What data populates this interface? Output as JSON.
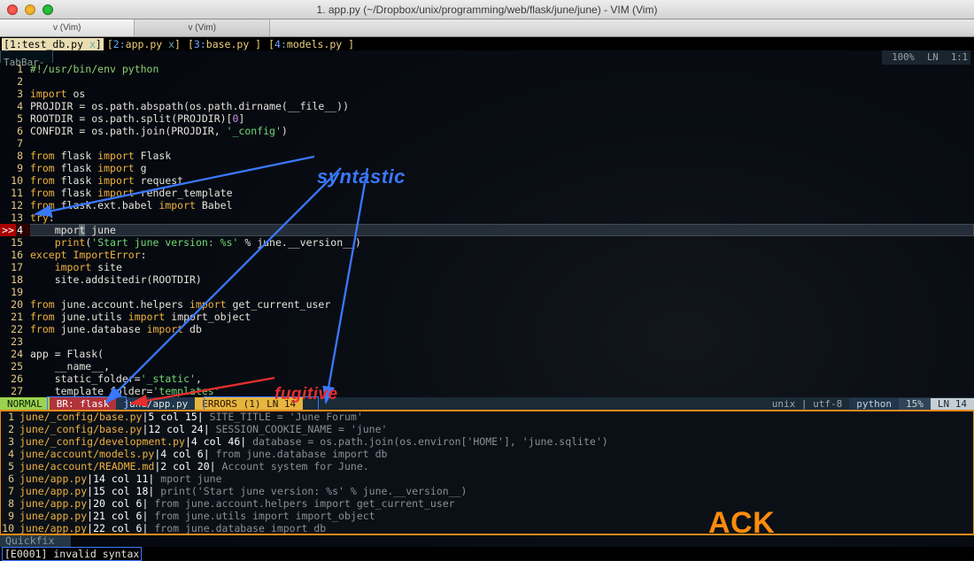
{
  "window": {
    "title": "1. app.py (~/Dropbox/unix/programming/web/flask/june/june) - VIM (Vim)",
    "mactabs": [
      "v (Vim)",
      "v (Vim)"
    ]
  },
  "buffers": [
    {
      "idx": "1",
      "name": "test_db.py",
      "active": true,
      "closable": true
    },
    {
      "idx": "2",
      "name": "app.py",
      "active": false,
      "closable": true
    },
    {
      "idx": "3",
      "name": "base.py",
      "active": false,
      "closable": false
    },
    {
      "idx": "4",
      "name": "models.py",
      "active": false,
      "closable": false
    }
  ],
  "tabbar_label": "-TabBar-",
  "topright": {
    "pct": "100%",
    "ln": "LN",
    "pos": "1:1"
  },
  "code": [
    {
      "n": 1,
      "html": "<span class='c'>#!/usr/bin/env python</span>"
    },
    {
      "n": 2,
      "html": ""
    },
    {
      "n": 3,
      "html": "<span class='imp'>import</span> os"
    },
    {
      "n": 4,
      "html": "PROJDIR = os.path.abspath(os.path.dirname(__file__))"
    },
    {
      "n": 5,
      "html": "ROOTDIR = os.path.split(PROJDIR)[<span class='num'>0</span>]"
    },
    {
      "n": 6,
      "html": "CONFDIR = os.path.join(PROJDIR, <span class='st'>'_config'</span>)"
    },
    {
      "n": 7,
      "html": ""
    },
    {
      "n": 8,
      "html": "<span class='imp'>from</span> flask <span class='imp'>import</span> Flask"
    },
    {
      "n": 9,
      "html": "<span class='imp'>from</span> flask <span class='imp'>import</span> g"
    },
    {
      "n": 10,
      "html": "<span class='imp'>from</span> flask <span class='imp'>import</span> request"
    },
    {
      "n": 11,
      "html": "<span class='imp'>from</span> flask <span class='imp'>import</span> render_template"
    },
    {
      "n": 12,
      "html": "<span class='imp'>from</span> flask.ext.babel <span class='imp'>import</span> Babel"
    },
    {
      "n": 13,
      "html": "<span class='imp'>try</span>:"
    },
    {
      "n": 14,
      "err": true,
      "cursor": true,
      "html": "    mpor<span class='curword'>t</span> june"
    },
    {
      "n": 15,
      "html": "    <span class='kw'>print</span>(<span class='st'>'Start june version: %s'</span> % june.__version__)"
    },
    {
      "n": 16,
      "html": "<span class='imp'>except</span> <span class='kw'>ImportError</span>:"
    },
    {
      "n": 17,
      "html": "    <span class='imp'>import</span> site"
    },
    {
      "n": 18,
      "html": "    site.addsitedir(ROOTDIR)"
    },
    {
      "n": 19,
      "html": ""
    },
    {
      "n": 20,
      "html": "<span class='imp'>from</span> june.account.helpers <span class='imp'>import</span> get_current_user"
    },
    {
      "n": 21,
      "html": "<span class='imp'>from</span> june.utils <span class='imp'>import</span> import_object"
    },
    {
      "n": 22,
      "html": "<span class='imp'>from</span> june.database <span class='imp'>import</span> db"
    },
    {
      "n": 23,
      "html": ""
    },
    {
      "n": 24,
      "html": "app = Flask("
    },
    {
      "n": 25,
      "html": "    __name__,"
    },
    {
      "n": 26,
      "html": "    static_folder=<span class='st'>'_static'</span>,"
    },
    {
      "n": 27,
      "html": "    template_folder=<span class='st'>'templates'</span>"
    }
  ],
  "status": {
    "mode": "NORMAL",
    "branch": "BR: flask",
    "file": "june/app.py",
    "errors": "ERRORS (1) LN 14",
    "enc": "unix | utf-8",
    "ft": "python",
    "pct": "15%",
    "ln": "LN  14"
  },
  "quickfix": [
    {
      "n": 1,
      "path": "june/_config/base.py",
      "pos": "5 col 15",
      "txt": " SITE_TITLE = 'June Forum'"
    },
    {
      "n": 2,
      "path": "june/_config/base.py",
      "pos": "12 col 24",
      "txt": " SESSION_COOKIE_NAME = 'june'"
    },
    {
      "n": 3,
      "path": "june/_config/development.py",
      "pos": "4 col 46",
      "txt": " database = os.path.join(os.environ['HOME'], 'june.sqlite')"
    },
    {
      "n": 4,
      "path": "june/account/models.py",
      "pos": "4 col 6",
      "txt": " from june.database import db"
    },
    {
      "n": 5,
      "path": "june/account/README.md",
      "pos": "2 col 20",
      "txt": " Account system for June."
    },
    {
      "n": 6,
      "path": "june/app.py",
      "pos": "14 col 11",
      "txt": " mport june"
    },
    {
      "n": 7,
      "path": "june/app.py",
      "pos": "15 col 18",
      "txt": " print('Start june version: %s' % june.__version__)"
    },
    {
      "n": 8,
      "path": "june/app.py",
      "pos": "20 col 6",
      "txt": " from june.account.helpers import get_current_user"
    },
    {
      "n": 9,
      "path": "june/app.py",
      "pos": "21 col 6",
      "txt": " from june.utils import import_object"
    },
    {
      "n": 10,
      "path": "june/app.py",
      "pos": "22 col 6",
      "txt": " from june.database import db"
    }
  ],
  "quickfix_label": "Quickfix",
  "cmdline": "[E0001] invalid syntax",
  "annotations": {
    "syntastic": "syntastic",
    "fugitive": "fugitive",
    "ack": "ACK"
  }
}
